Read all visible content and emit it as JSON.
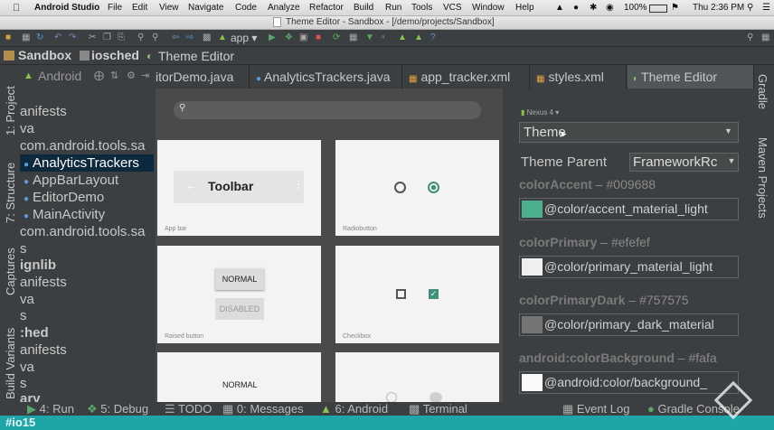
{
  "mac_menu": {
    "app": "Android Studio",
    "items": [
      "File",
      "Edit",
      "View",
      "Navigate",
      "Code",
      "Analyze",
      "Refactor",
      "Build",
      "Run",
      "Tools",
      "VCS",
      "Window",
      "Help"
    ],
    "battery": "100%",
    "clock": "Thu 2:36 PM"
  },
  "window": {
    "title": "Theme Editor - Sandbox - [/demo/projects/Sandbox]"
  },
  "toolbar": {
    "run_config": "app"
  },
  "breadcrumbs": [
    "Sandbox",
    "iosched",
    "Theme Editor"
  ],
  "left_strip": {
    "project": "1: Project",
    "structure": "7: Structure",
    "captures": "Captures",
    "build_variants": "Build Variants"
  },
  "right_strip": {
    "gradle": "Gradle",
    "maven": "Maven Projects"
  },
  "project_header": "Android",
  "tree": [
    "anifests",
    "va",
    "com.android.tools.sa",
    "AnalyticsTrackers",
    "AppBarLayout",
    "EditorDemo",
    "MainActivity",
    "com.android.tools.sa",
    "s",
    "ignlib",
    "anifests",
    "va",
    "s",
    ":hed",
    "anifests",
    "va",
    "s",
    "ary"
  ],
  "tabs": [
    "itorDemo.java",
    "AnalyticsTrackers.java",
    "app_tracker.xml",
    "styles.xml",
    "Theme Editor"
  ],
  "preview": {
    "toolbar_label": "Toolbar",
    "captions": [
      "App bar",
      "Radiobutton",
      "Raised button",
      "Checkbox"
    ],
    "normal": "NORMAL",
    "disabled": "DISABLED"
  },
  "theme_editor": {
    "device": "Nexus 4",
    "theme_select": "Theme",
    "parent_label": "Theme Parent",
    "parent_value": "FrameworkRc",
    "attributes": [
      {
        "name": "colorAccent",
        "value": "#009688",
        "ref": "@color/accent_material_light",
        "swatch": "#4caf8e"
      },
      {
        "name": "colorPrimary",
        "value": "#efefef",
        "ref": "@color/primary_material_light",
        "swatch": "#efefef"
      },
      {
        "name": "colorPrimaryDark",
        "value": "#757575",
        "ref": "@color/primary_dark_material",
        "swatch": "#757575"
      },
      {
        "name": "android:colorBackground",
        "value": "#fafa",
        "ref": "@android:color/background_",
        "swatch": "#fafafa"
      }
    ]
  },
  "bottom_tools": [
    "4: Run",
    "5: Debug",
    "TODO",
    "0: Messages",
    "6: Android",
    "Terminal",
    "Event Log",
    "Gradle Console"
  ],
  "hashtag": "#io15",
  "colors": {
    "accent_teal": "#009688",
    "hashtag_bar": "#1da5a8"
  }
}
